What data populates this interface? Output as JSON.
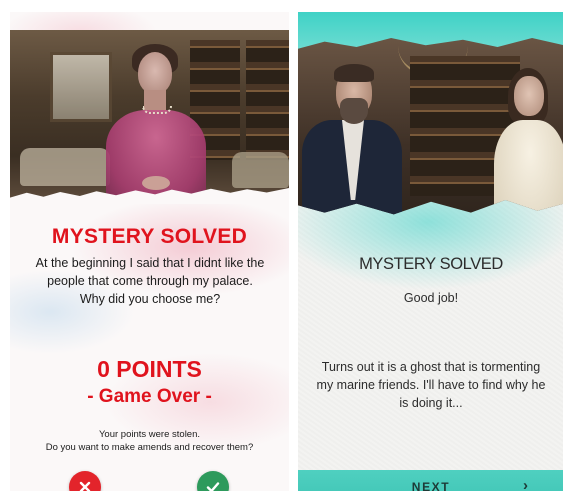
{
  "left_screen": {
    "title": "MYSTERY SOLVED",
    "message": "At the beginning I said that I didnt like the people that come through my palace. Why did you choose me?",
    "points": "0 POINTS",
    "game_over": "- Game Over -",
    "note_line1": "Your points were stolen.",
    "note_line2": "Do you want to make amends and recover them?",
    "decline_icon": "close-icon",
    "accept_icon": "checkmark-icon",
    "colors": {
      "accent_red": "#e0131d",
      "decline": "#e3242b",
      "accept": "#2d9a5c"
    }
  },
  "right_screen": {
    "title": "MYSTERY SOLVED",
    "subtitle": "Good job!",
    "story": "Turns out it is a ghost that is tormenting my marine friends. I'll have to find why he is doing it...",
    "next_label": "NEXT",
    "next_icon": "chevron-right-icon",
    "colors": {
      "accent_teal": "#40c5b5"
    }
  }
}
